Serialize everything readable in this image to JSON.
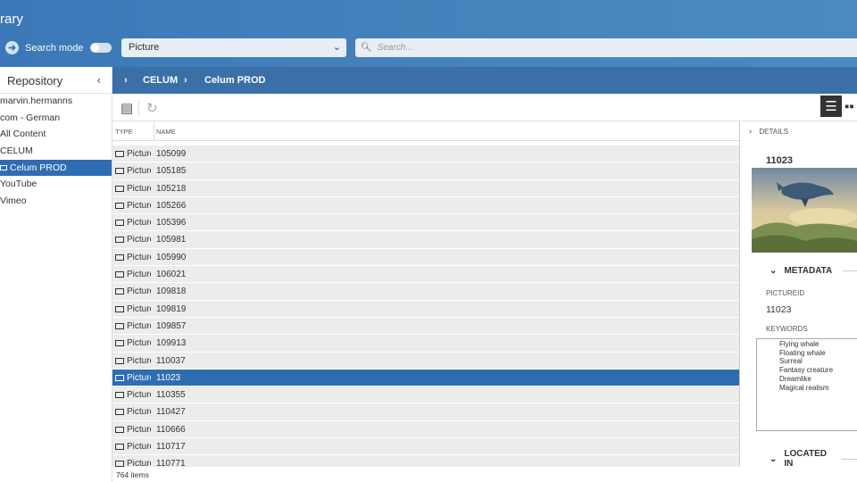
{
  "header": {
    "title": "rary",
    "search_mode_label": "Search mode",
    "type_select": "Picture",
    "search_placeholder": "Search..."
  },
  "sidebar": {
    "title": "Repository",
    "items": [
      {
        "label": "marvin.hermanns"
      },
      {
        "label": "com - German"
      },
      {
        "label": "All Content"
      },
      {
        "label": "CELUM"
      },
      {
        "label": "Celum PROD",
        "selected": true
      },
      {
        "label": "YouTube"
      },
      {
        "label": "Vimeo"
      }
    ]
  },
  "breadcrumb": {
    "sep": "›",
    "items": [
      "CELUM",
      "Celum PROD"
    ]
  },
  "list": {
    "col_type": "TYPE",
    "col_name": "NAME",
    "rows": [
      {
        "type": "Picture",
        "name": "105099"
      },
      {
        "type": "Picture",
        "name": "105185"
      },
      {
        "type": "Picture",
        "name": "105218"
      },
      {
        "type": "Picture",
        "name": "105266"
      },
      {
        "type": "Picture",
        "name": "105396"
      },
      {
        "type": "Picture",
        "name": "105981"
      },
      {
        "type": "Picture",
        "name": "105990"
      },
      {
        "type": "Picture",
        "name": "106021"
      },
      {
        "type": "Picture",
        "name": "109818"
      },
      {
        "type": "Picture",
        "name": "109819"
      },
      {
        "type": "Picture",
        "name": "109857"
      },
      {
        "type": "Picture",
        "name": "109913"
      },
      {
        "type": "Picture",
        "name": "110037"
      },
      {
        "type": "Picture",
        "name": "11023",
        "selected": true
      },
      {
        "type": "Picture",
        "name": "110355"
      },
      {
        "type": "Picture",
        "name": "110427"
      },
      {
        "type": "Picture",
        "name": "110666"
      },
      {
        "type": "Picture",
        "name": "110717"
      },
      {
        "type": "Picture",
        "name": "110771"
      }
    ],
    "count": "764 items"
  },
  "details": {
    "header": "DETAILS",
    "asset_id": "11023",
    "metadata_title": "METADATA",
    "pictureid_label": "PICTUREID",
    "pictureid_value": "11023",
    "keywords_label": "KEYWORDS",
    "keywords": [
      "Flying whale",
      "Floating whale",
      "Surreal",
      "Fantasy creature",
      "Dreamlike",
      "Magical realism"
    ],
    "located_in_title": "LOCATED IN"
  },
  "colors": {
    "header_blue": "#3c78b8",
    "selection_blue": "#2f6db3",
    "crumb_blue": "#3a6fa8"
  }
}
